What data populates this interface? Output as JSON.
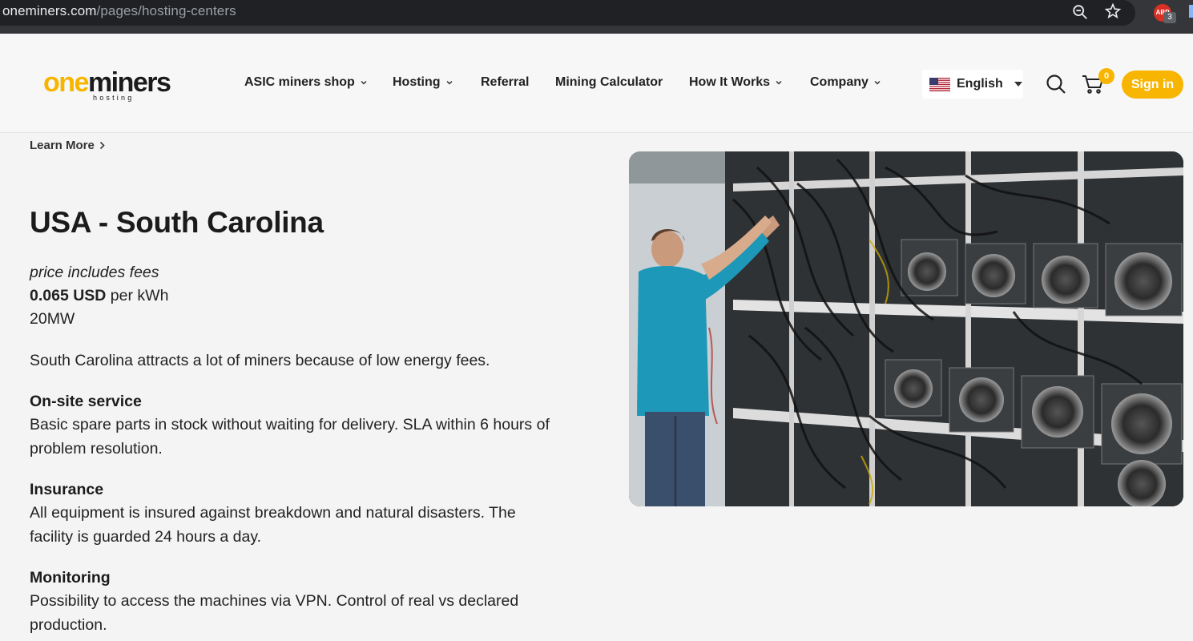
{
  "browser": {
    "url_host": "oneminers.com",
    "url_path": "/pages/hosting-centers",
    "extension_label": "ABP",
    "extension_badge": "3"
  },
  "header": {
    "logo": {
      "part1": "one",
      "part2": "miners",
      "subtitle": "hosting"
    },
    "nav": [
      {
        "label": "ASIC miners shop",
        "has_dropdown": true
      },
      {
        "label": "Hosting",
        "has_dropdown": true
      },
      {
        "label": "Referral",
        "has_dropdown": false
      },
      {
        "label": "Mining Calculator",
        "has_dropdown": false
      },
      {
        "label": "How It Works",
        "has_dropdown": true
      },
      {
        "label": "Company",
        "has_dropdown": true
      }
    ],
    "language": "English",
    "cart_count": "0",
    "signin_label": "Sign in",
    "colors": {
      "accent": "#f7b500"
    }
  },
  "content": {
    "learn_more": "Learn More",
    "title": "USA - South Carolina",
    "fees_note": "price includes fees",
    "price_value": "0.065 USD",
    "price_unit": " per kWh",
    "capacity": "20MW",
    "description": "South Carolina attracts a lot of miners because of low energy fees.",
    "features": [
      {
        "title": "On-site service",
        "text": "Basic spare parts in stock without waiting for delivery. SLA within 6 hours of problem resolution."
      },
      {
        "title": "Insurance",
        "text": "All equipment is insured against breakdown and natural disasters. The facility is guarded 24 hours a day."
      },
      {
        "title": "Monitoring",
        "text": "Possibility to access the machines via VPN. Control of real vs declared production."
      }
    ],
    "photo_icon": "mining-facility-photo"
  }
}
